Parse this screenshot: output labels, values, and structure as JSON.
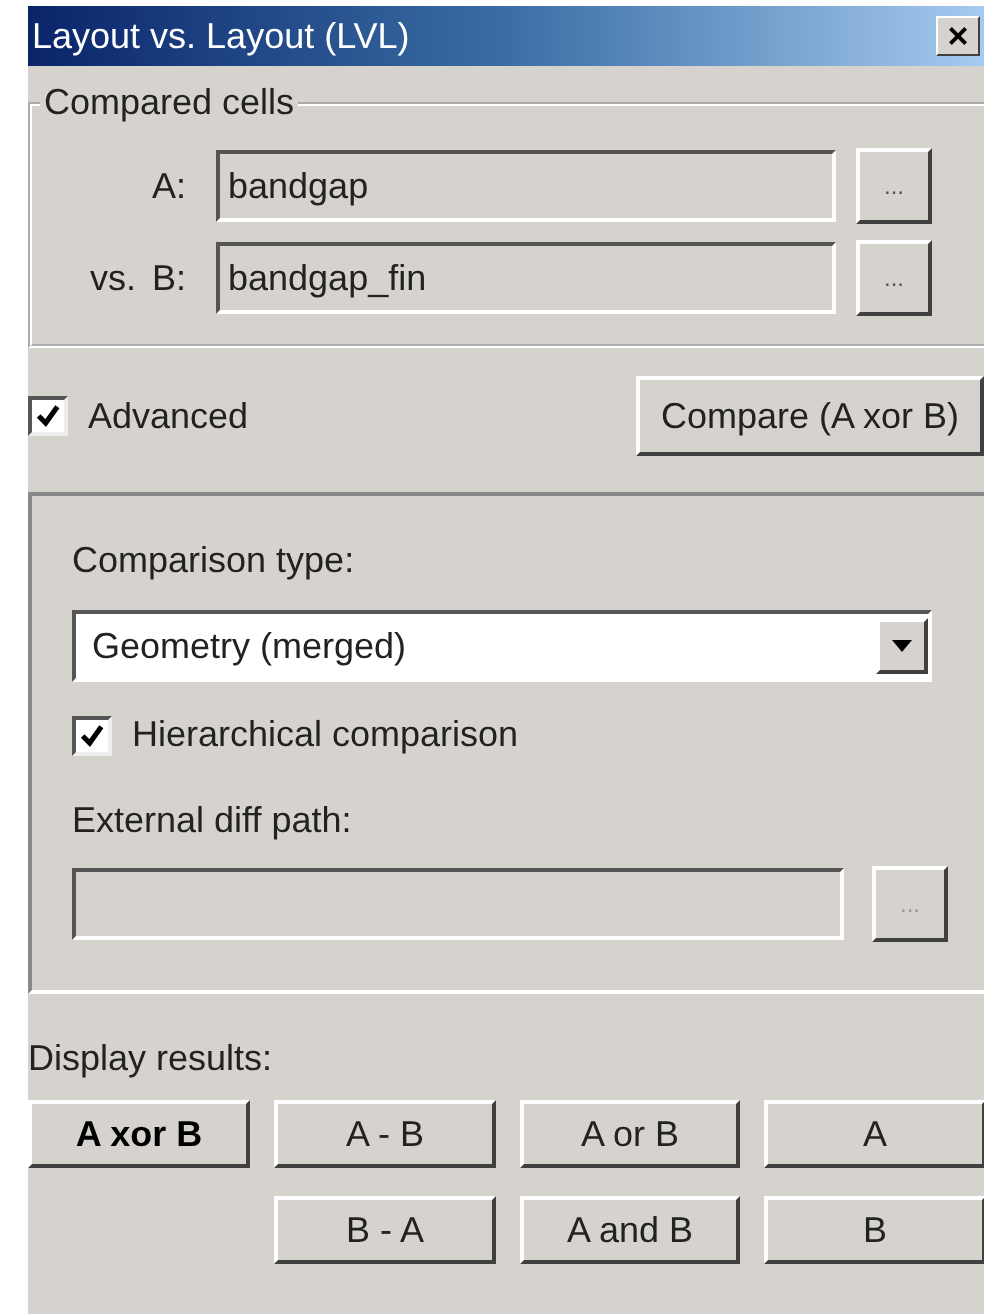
{
  "window": {
    "title": "Layout vs. Layout (LVL)",
    "close": "×"
  },
  "compared_cells": {
    "title": "Compared cells",
    "fields": [
      {
        "label": "A:",
        "value": "bandgap",
        "browse": "..."
      },
      {
        "prefix": "vs.",
        "label": "B:",
        "value": "bandgap_fin",
        "browse": "..."
      }
    ]
  },
  "advanced": {
    "label": "Advanced",
    "checked": true
  },
  "compare_button": "Compare (A xor B)",
  "advanced_panel": {
    "comparison_type_label": "Comparison type:",
    "comparison_type": "Geometry (merged)",
    "hierarchical": {
      "label": "Hierarchical comparison",
      "checked": true
    },
    "external_diff_label": "External diff path:",
    "external_diff": {
      "disabled": true,
      "browse": "..."
    }
  },
  "display_results": {
    "label": "Display results:",
    "buttons": [
      {
        "label": "A xor B",
        "selected": true
      },
      {
        "label": "A - B",
        "selected": false
      },
      {
        "label": "A or B",
        "selected": false
      },
      {
        "label": "A",
        "selected": false
      },
      {
        "label": "B - A",
        "selected": false
      },
      {
        "label": "A and B",
        "selected": false
      },
      {
        "label": "B",
        "selected": false
      }
    ]
  }
}
